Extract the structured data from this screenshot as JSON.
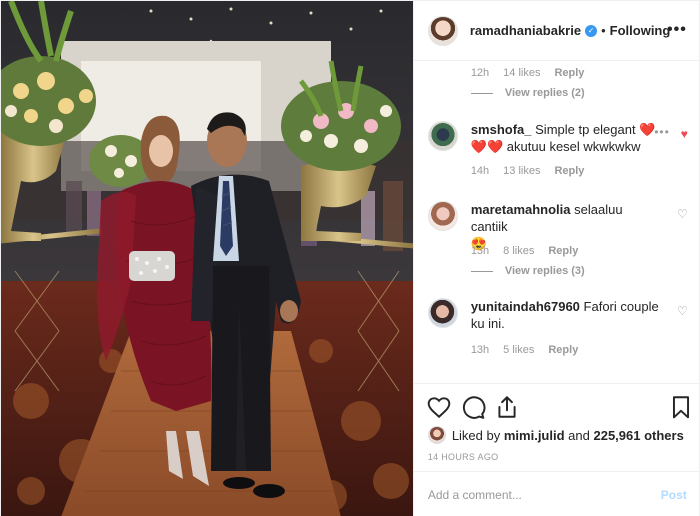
{
  "header": {
    "username": "ramadhaniabakrie",
    "separator": "•",
    "follow_state": "Following",
    "more": "•••"
  },
  "first_meta": {
    "time": "12h",
    "likes": "14 likes",
    "reply": "Reply",
    "view_replies": "View replies (2)"
  },
  "comments": [
    {
      "username": "smshofa_",
      "text_a": "Simple tp elegant ",
      "emoji_a": "❤️",
      "emoji_b": "❤️❤️",
      "text_b": " akutuu kesel wkwkwkw",
      "time": "14h",
      "likes": "13 likes",
      "reply": "Reply",
      "liked": true
    },
    {
      "username": "maretamahnolia",
      "text": "selaaluu cantiik",
      "emoji": "😍",
      "time": "13h",
      "likes": "8 likes",
      "reply": "Reply",
      "view_replies": "View replies (3)"
    },
    {
      "username": "yunitaindah67960",
      "text": "Fafori couple ku ini.",
      "time": "13h",
      "likes": "5 likes",
      "reply": "Reply"
    }
  ],
  "actions": {
    "liked_by_label": "Liked by",
    "liked_by_user": "mimi.julid",
    "and_label": "and",
    "others_count": "225,961 others",
    "time_ago": "14 HOURS AGO"
  },
  "add_comment": {
    "placeholder": "Add a comment...",
    "post_label": "Post"
  },
  "colors": {
    "accent_blue": "#3897f0",
    "like_red": "#ed4956",
    "muted": "#999999"
  }
}
